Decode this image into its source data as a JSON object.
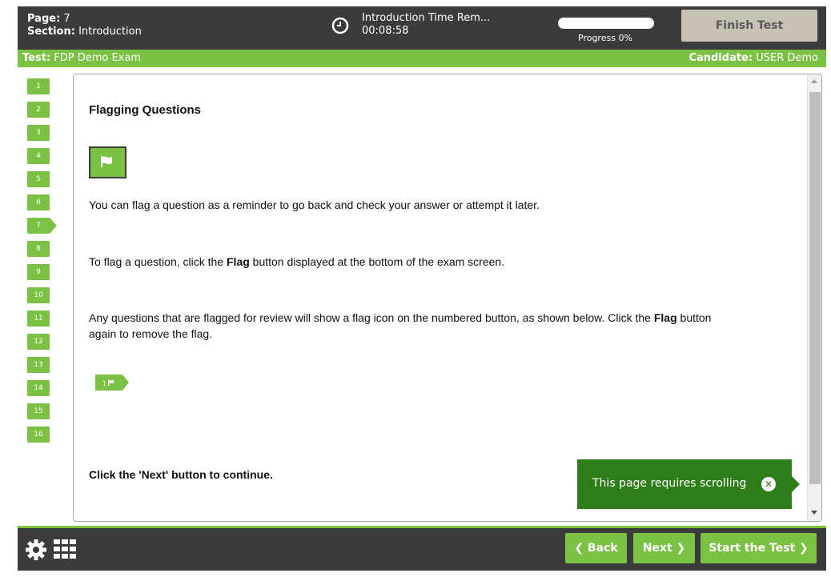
{
  "header": {
    "page_label": "Page:",
    "page_value": "7",
    "section_label": "Section:",
    "section_value": "Introduction",
    "timer_title": "Introduction Time Rem...",
    "timer_value": "00:08:58",
    "progress_label": "Progress 0%",
    "progress_fraction": 0,
    "finish_button": "Finish Test"
  },
  "infobar": {
    "test_label": "Test:",
    "test_value": "FDP Demo Exam",
    "candidate_label": "Candidate:",
    "candidate_value": "USER Demo"
  },
  "nav": {
    "questions": [
      "1",
      "2",
      "3",
      "4",
      "5",
      "6",
      "7",
      "8",
      "9",
      "10",
      "11",
      "12",
      "13",
      "14",
      "15",
      "16"
    ],
    "active": "7"
  },
  "content": {
    "title": "Flagging Questions",
    "p1": "You can flag a question as a reminder to go back and check your answer or attempt it later.",
    "p2_pre": "To flag a question, click the ",
    "p2_bold": "Flag",
    "p2_post": " button displayed at the bottom of the exam screen.",
    "p3_pre": "Any questions that are flagged for review will show a flag icon on the numbered button, as shown below. Click the ",
    "p3_bold": "Flag",
    "p3_post": " button again to remove the flag.",
    "sample_button_number": "1",
    "next_instruction": "Click the 'Next' button to continue."
  },
  "toast": {
    "text": "This page requires scrolling"
  },
  "footer": {
    "back": "❮ Back",
    "next": "Next ❯",
    "start": "Start the Test ❯"
  },
  "colors": {
    "accent": "#7bc143",
    "dark": "#3b3b3b",
    "toast": "#2e7d1a",
    "finish": "#c8c2b4"
  },
  "icons": [
    "clock-icon",
    "flag-icon",
    "gear-icon",
    "grid-icon",
    "close-icon"
  ]
}
